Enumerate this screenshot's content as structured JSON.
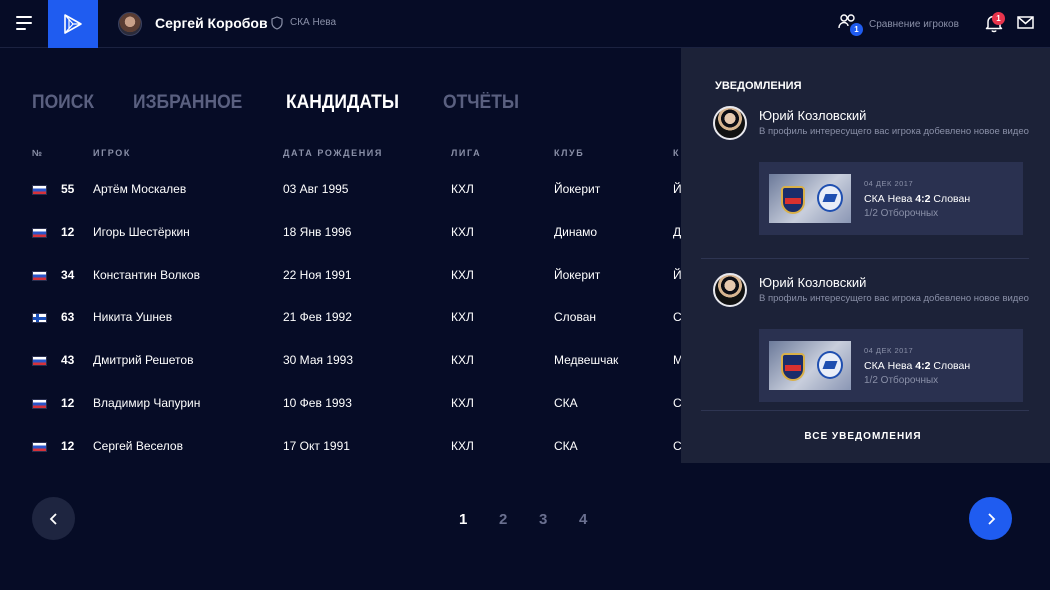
{
  "header": {
    "user_name": "Сергей Коробов",
    "team_name": "СКА Нева",
    "compare_label": "Сравнение игроков",
    "compare_count": "1",
    "notifications_count": "1",
    "icons": [
      "menu-icon",
      "logo-play-icon",
      "shield-icon",
      "compare-players-icon",
      "bell-icon",
      "mail-icon"
    ]
  },
  "tabs": [
    {
      "label": "ПОИСК",
      "active": false
    },
    {
      "label": "ИЗБРАННОЕ",
      "active": false
    },
    {
      "label": "КАНДИДАТЫ",
      "active": true
    },
    {
      "label": "ОТЧЁТЫ",
      "active": false
    }
  ],
  "table": {
    "headers": [
      "№",
      "ИГРОК",
      "ДАТА РОЖДЕНИЯ",
      "ЛИГА",
      "КЛУБ",
      "К"
    ],
    "rows": [
      {
        "flag": "ru",
        "number": "55",
        "player": "Артём Москалев",
        "birth": "03 Авг 1995",
        "league": "КХЛ",
        "club": "Йокерит",
        "extra": "Й"
      },
      {
        "flag": "ru",
        "number": "12",
        "player": "Игорь Шестёркин",
        "birth": "18 Янв 1996",
        "league": "КХЛ",
        "club": "Динамо",
        "extra": "Д"
      },
      {
        "flag": "ru",
        "number": "34",
        "player": "Константин Волков",
        "birth": "22 Ноя 1991",
        "league": "КХЛ",
        "club": "Йокерит",
        "extra": "Й"
      },
      {
        "flag": "fi",
        "number": "63",
        "player": "Никита Ушнев",
        "birth": "21 Фев 1992",
        "league": "КХЛ",
        "club": "Слован",
        "extra": "С"
      },
      {
        "flag": "ru",
        "number": "43",
        "player": "Дмитрий Решетов",
        "birth": "30 Мая 1993",
        "league": "КХЛ",
        "club": "Медвешчак",
        "extra": "М"
      },
      {
        "flag": "ru",
        "number": "12",
        "player": "Владимир Чапурин",
        "birth": "10 Фев 1993",
        "league": "КХЛ",
        "club": "СКА",
        "extra": "С"
      },
      {
        "flag": "ru",
        "number": "12",
        "player": "Сергей Веселов",
        "birth": "17 Окт 1991",
        "league": "КХЛ",
        "club": "СКА",
        "extra": "С"
      }
    ]
  },
  "pagination": {
    "pages": [
      "1",
      "2",
      "3",
      "4"
    ],
    "current": "1"
  },
  "notifications": {
    "title": "УВЕДОМЛЕНИЯ",
    "items": [
      {
        "name": "Юрий Козловский",
        "text": "В профиль интересущего вас игрока добевлено новое видео",
        "date": "04 ДЕК 2017",
        "team_a": "СКА Нева",
        "score": "4:2",
        "team_b": "Слован",
        "stage": "1/2 Отборочных"
      },
      {
        "name": "Юрий Козловский",
        "text": "В профиль интересущего вас игрока добевлено новое видео",
        "date": "04 ДЕК 2017",
        "team_a": "СКА Нева",
        "score": "4:2",
        "team_b": "Слован",
        "stage": "1/2 Отборочных"
      }
    ],
    "all_label": "ВСЕ УВЕДОМЛЕНИЯ"
  },
  "colors": {
    "background": "#060c26",
    "accent": "#1f5cf0",
    "panel": "#1c2238",
    "badge": "#e8344c"
  }
}
